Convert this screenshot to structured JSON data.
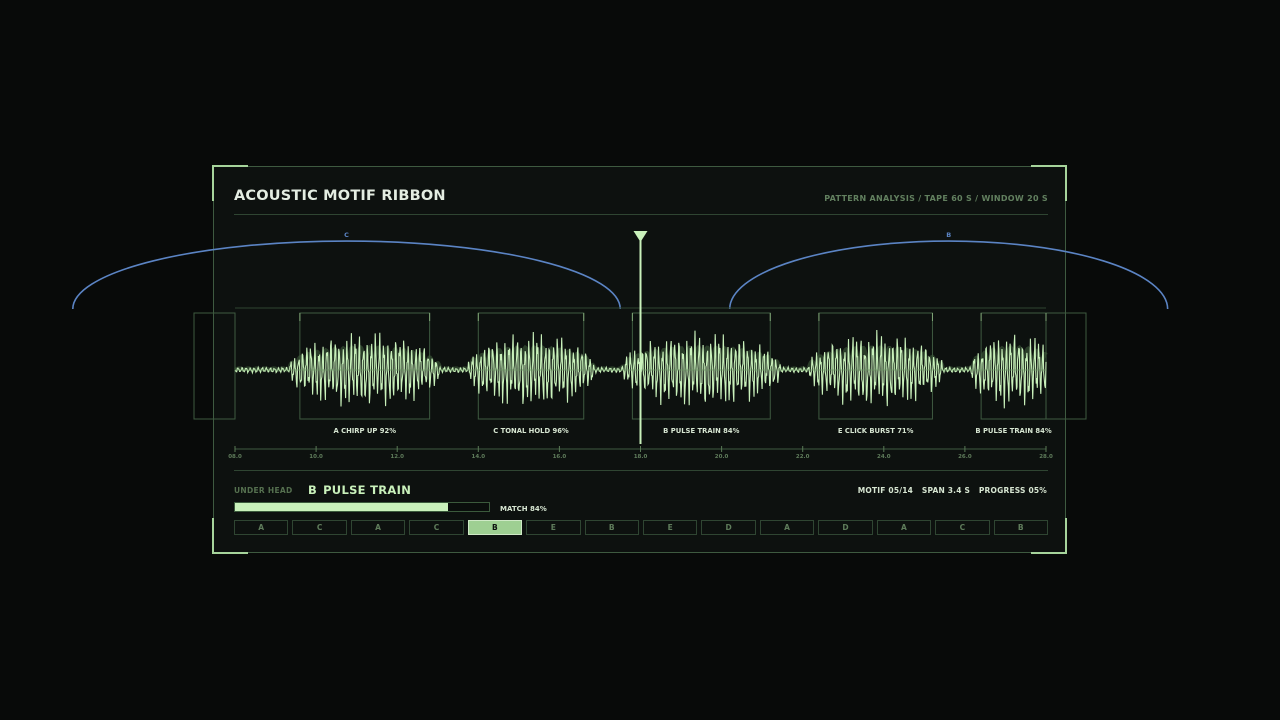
{
  "header": {
    "title": "ACOUSTIC MOTIF RIBBON",
    "subtitle": "PATTERN ANALYSIS / TAPE 60 S / WINDOW 20 S"
  },
  "arcs": [
    {
      "label": "C",
      "from_t": 4.0,
      "to_t": 17.5
    },
    {
      "label": "B",
      "from_t": 20.2,
      "to_t": 31.0
    }
  ],
  "motifs": [
    {
      "id": "A",
      "name": "CHIRP UP",
      "match": "92%",
      "start_t": 9.6,
      "end_t": 12.8
    },
    {
      "id": "C",
      "name": "TONAL HOLD",
      "match": "96%",
      "start_t": 14.0,
      "end_t": 16.6
    },
    {
      "id": "B",
      "name": "PULSE TRAIN",
      "match": "84%",
      "start_t": 17.8,
      "end_t": 21.2
    },
    {
      "id": "E",
      "name": "CLICK BURST",
      "match": "71%",
      "start_t": 22.4,
      "end_t": 25.2
    },
    {
      "id": "B",
      "name": "PULSE TRAIN",
      "match": "84%",
      "start_t": 26.4,
      "end_t": 28.0
    }
  ],
  "timeline": {
    "start": 8.0,
    "end": 28.0,
    "ticks": [
      "08.0",
      "10.0",
      "12.0",
      "14.0",
      "16.0",
      "18.0",
      "20.0",
      "22.0",
      "24.0",
      "26.0",
      "28.0"
    ],
    "playhead_t": 18.0
  },
  "status": {
    "under_head_label": "UNDER HEAD",
    "current_motif_id": "B",
    "current_motif_name": "PULSE TRAIN",
    "motif": "MOTIF 05/14",
    "span": "SPAN  3.4 S",
    "progress": "PROGRESS 05%",
    "match_fraction": 0.84,
    "match_label": "MATCH 84%"
  },
  "sequence": [
    "A",
    "C",
    "A",
    "C",
    "B",
    "E",
    "B",
    "E",
    "D",
    "A",
    "D",
    "A",
    "C",
    "B"
  ],
  "sequence_active_index": 4,
  "colors": {
    "accent": "#c9f1bb",
    "arc": "#5b84c4",
    "frame": "#3e5a40",
    "background": "#080a09"
  }
}
